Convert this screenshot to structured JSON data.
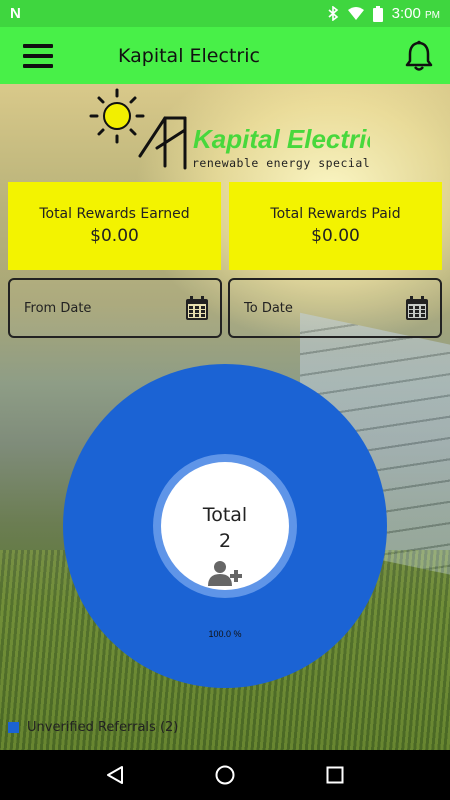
{
  "status_bar": {
    "time": "3:00",
    "ampm": "PM",
    "notification_icon": "n-icon"
  },
  "app_bar": {
    "title": "Kapital Electric",
    "menu_icon": "hamburger-menu-icon",
    "bell_icon": "bell-icon",
    "color": "#48f048"
  },
  "logo": {
    "name": "Kapital Electric",
    "tagline": "renewable energy specialists"
  },
  "cards": [
    {
      "label": "Total Rewards Earned",
      "value": "$0.00"
    },
    {
      "label": "Total Rewards Paid",
      "value": "$0.00"
    }
  ],
  "date_filters": {
    "from": {
      "placeholder": "From Date",
      "icon": "calendar-icon"
    },
    "to": {
      "placeholder": "To Date",
      "icon": "calendar-icon"
    }
  },
  "chart_data": {
    "type": "pie",
    "categories": [
      "Unverified Referrals (2)"
    ],
    "values": [
      100.0
    ],
    "percent_label": "100.0 %",
    "center_label": "Total",
    "center_value": "2",
    "colors": [
      "#1b63d4"
    ],
    "legend_position": "bottom-left"
  },
  "legend": {
    "items": [
      {
        "label": "Unverified Referrals (2)",
        "color": "#1b63d4"
      }
    ]
  },
  "nav_bar": {
    "back_icon": "back-triangle-icon",
    "home_icon": "home-circle-icon",
    "recents_icon": "recents-square-icon"
  }
}
